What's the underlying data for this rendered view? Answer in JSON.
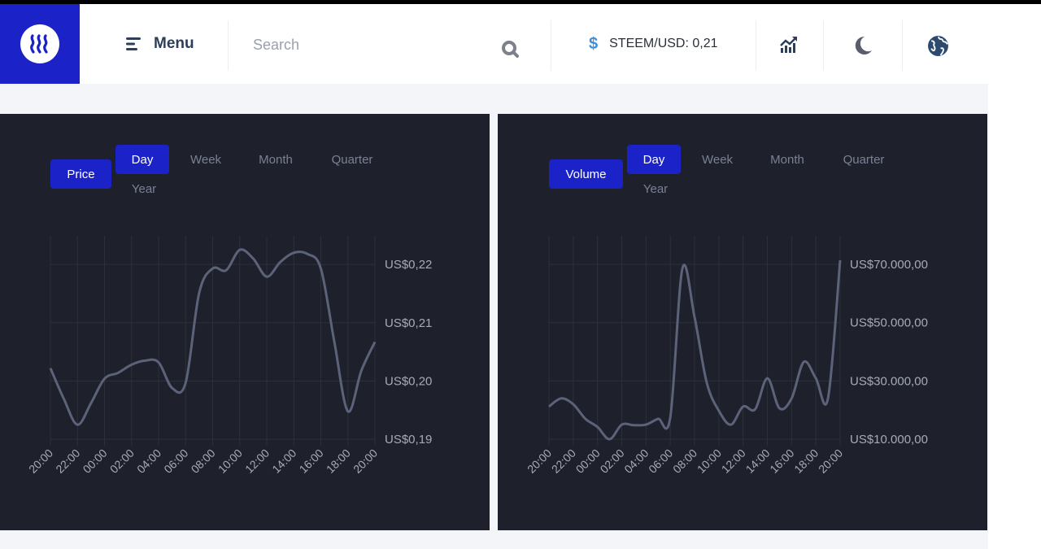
{
  "header": {
    "menu_label": "Menu",
    "search_placeholder": "Search",
    "price_label": "STEEM/USD: 0,21",
    "icons": [
      "steem-logo",
      "menu-icon",
      "search-icon",
      "dollar-icon",
      "chart-trend-icon",
      "moon-icon",
      "globe-icon"
    ]
  },
  "colors": {
    "accent": "#1a22c8",
    "panel": "#1e212b",
    "line": "#5c6279",
    "grid": "#2c303b"
  },
  "price_panel": {
    "metric_label": "Price",
    "ranges": [
      "Day",
      "Week",
      "Month",
      "Quarter",
      "Year"
    ],
    "selected": "Day"
  },
  "volume_panel": {
    "metric_label": "Volume",
    "ranges": [
      "Day",
      "Week",
      "Month",
      "Quarter",
      "Year"
    ],
    "selected": "Day"
  },
  "chart_data": [
    {
      "type": "line",
      "title": "",
      "xlabel": "",
      "ylabel": "",
      "grid": true,
      "x_ticks": [
        "20:00",
        "22:00",
        "00:00",
        "02:00",
        "04:00",
        "06:00",
        "08:00",
        "10:00",
        "12:00",
        "14:00",
        "16:00",
        "18:00",
        "20:00"
      ],
      "y_ticks": [
        0.22,
        0.21,
        0.2,
        0.19
      ],
      "y_tick_labels": [
        "US$0,22",
        "US$0,21",
        "US$0,20",
        "US$0,19"
      ],
      "ylim": [
        0.1889,
        0.2249
      ],
      "values": [
        0.2022,
        0.1969,
        0.1925,
        0.1962,
        0.2004,
        0.2014,
        0.2028,
        0.2035,
        0.2032,
        0.1988,
        0.1997,
        0.2151,
        0.2193,
        0.219,
        0.2225,
        0.221,
        0.2179,
        0.2204,
        0.222,
        0.2218,
        0.2193,
        0.2067,
        0.1948,
        0.2018,
        0.2067
      ]
    },
    {
      "type": "line",
      "title": "",
      "xlabel": "",
      "ylabel": "",
      "grid": true,
      "x_ticks": [
        "20:00",
        "22:00",
        "00:00",
        "02:00",
        "04:00",
        "06:00",
        "08:00",
        "10:00",
        "12:00",
        "14:00",
        "16:00",
        "18:00",
        "20:00"
      ],
      "y_ticks": [
        70000,
        50000,
        30000,
        10000
      ],
      "y_tick_labels": [
        "US$70.000,00",
        "US$50.000,00",
        "US$30.000,00",
        "US$10.000,00"
      ],
      "ylim": [
        7770,
        79770
      ],
      "values": [
        21200,
        24000,
        22000,
        17000,
        14200,
        10000,
        15000,
        14800,
        15000,
        17000,
        17500,
        68600,
        51900,
        29500,
        19800,
        15000,
        21200,
        20300,
        30900,
        20600,
        24000,
        36500,
        30900,
        24000,
        71400
      ]
    }
  ]
}
